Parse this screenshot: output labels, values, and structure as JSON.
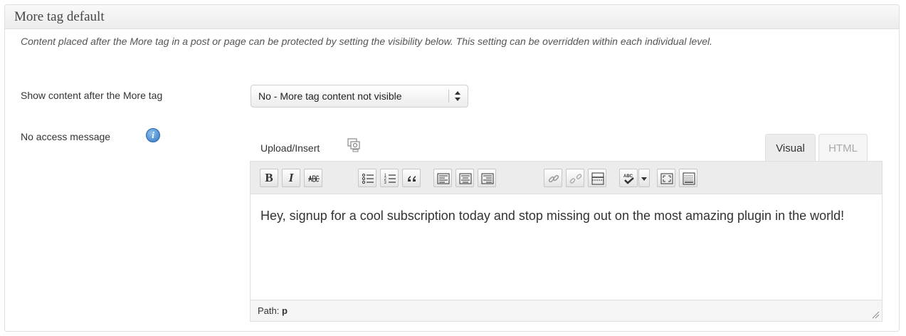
{
  "section": {
    "title": "More tag default",
    "description": "Content placed after the More tag in a post or page can be protected by setting the visibility below. This setting can be overridden within each individual level."
  },
  "fields": {
    "show_content_label": "Show content after the More tag",
    "show_content_value": "No - More tag content not visible",
    "no_access_label": "No access message"
  },
  "editor": {
    "upload_label": "Upload/Insert",
    "tabs": [
      {
        "label": "Visual",
        "active": true
      },
      {
        "label": "HTML",
        "active": false
      }
    ],
    "toolbar": {
      "bold_label": "B",
      "italic_label": "I"
    },
    "content": "Hey, signup for a cool subscription today and stop missing out on the most amazing plugin in the world!",
    "path_label": "Path:",
    "path_value": "p"
  }
}
